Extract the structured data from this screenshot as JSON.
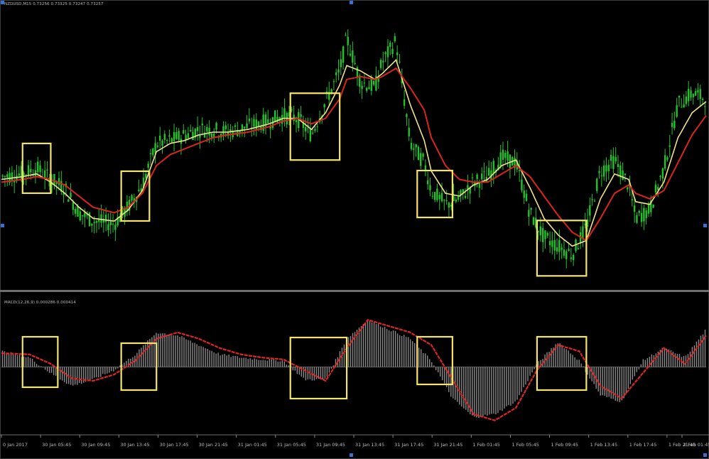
{
  "chart_data": [
    {
      "type": "line",
      "panel": "price",
      "title": "NZDUSD,M15 0.73256 0.73325 0.73247 0.73257",
      "x_ticks": [
        "0 Jan 2017",
        "30 Jan 05:45",
        "30 Jan 09:45",
        "30 Jan 13:45",
        "30 Jan 17:45",
        "30 Jan 21:45",
        "31 Jan 01:45",
        "31 Jan 05:45",
        "31 Jan 09:45",
        "31 Jan 13:45",
        "31 Jan 17:45",
        "31 Jan 21:45",
        "1 Feb 01:45",
        "1 Feb 05:45",
        "1 Feb 09:45",
        "1 Feb 13:45",
        "1 Feb 17:45",
        "1 Feb 21:45",
        "2 Feb 01:45"
      ],
      "x_range": [
        0,
        100
      ],
      "ylim": [
        0,
        100
      ],
      "series": [
        {
          "color": "#22c32a",
          "style": "candles",
          "x": [
            0,
            3,
            5,
            7,
            9,
            11,
            13,
            16,
            18,
            20,
            22,
            24,
            26,
            28,
            30,
            32,
            35,
            38,
            40,
            42,
            44,
            46,
            48,
            49,
            51,
            53,
            54,
            56,
            58,
            60,
            61,
            63,
            65,
            67,
            69,
            71,
            73,
            75,
            77,
            79,
            81,
            83,
            85,
            87,
            89,
            90,
            92,
            94,
            96,
            98,
            100
          ],
          "values": [
            40,
            41,
            43,
            39,
            36,
            27,
            24,
            23,
            29,
            37,
            52,
            53,
            55,
            57,
            57,
            56,
            58,
            60,
            62,
            61,
            55,
            67,
            78,
            90,
            74,
            72,
            81,
            89,
            52,
            45,
            35,
            30,
            32,
            38,
            40,
            47,
            45,
            27,
            18,
            15,
            12,
            22,
            42,
            46,
            37,
            25,
            28,
            43,
            66,
            70,
            68
          ]
        },
        {
          "color": "#f2e28c",
          "style": "line",
          "x": [
            0,
            3,
            5,
            7,
            9,
            11,
            13,
            16,
            18,
            20,
            22,
            24,
            26,
            28,
            30,
            32,
            35,
            38,
            40,
            42,
            44,
            46,
            48,
            49,
            51,
            53,
            54,
            56,
            58,
            60,
            61,
            63,
            65,
            67,
            69,
            71,
            73,
            75,
            77,
            79,
            81,
            83,
            85,
            87,
            89,
            90,
            92,
            94,
            96,
            98,
            100
          ],
          "values": [
            39,
            40,
            41,
            38,
            34,
            29,
            25,
            24,
            28,
            35,
            49,
            52,
            53,
            55,
            56,
            56,
            57,
            59,
            61,
            61,
            57,
            63,
            73,
            80,
            78,
            75,
            77,
            82,
            66,
            53,
            42,
            34,
            33,
            37,
            39,
            44,
            46,
            36,
            25,
            19,
            15,
            17,
            32,
            41,
            39,
            31,
            30,
            38,
            54,
            63,
            67
          ]
        },
        {
          "color": "#d9261c",
          "style": "line",
          "x": [
            0,
            3,
            5,
            7,
            9,
            11,
            13,
            16,
            18,
            20,
            22,
            24,
            26,
            28,
            30,
            32,
            35,
            38,
            40,
            42,
            44,
            46,
            48,
            49,
            51,
            53,
            54,
            56,
            58,
            60,
            61,
            63,
            65,
            67,
            69,
            71,
            73,
            75,
            77,
            79,
            81,
            83,
            85,
            87,
            89,
            90,
            92,
            94,
            96,
            98,
            100
          ],
          "values": [
            38,
            39,
            40,
            39,
            37,
            33,
            29,
            27,
            29,
            34,
            44,
            48,
            50,
            52,
            54,
            55,
            56,
            58,
            60,
            61,
            59,
            61,
            68,
            75,
            76,
            75,
            76,
            79,
            72,
            64,
            54,
            44,
            39,
            38,
            38,
            41,
            44,
            40,
            33,
            26,
            20,
            17,
            25,
            34,
            37,
            34,
            32,
            35,
            45,
            55,
            62
          ]
        }
      ],
      "annotations": {
        "type": "highlight-box",
        "color": "#f4e567",
        "x_ranges": [
          [
            3,
            7
          ],
          [
            17,
            21
          ],
          [
            41,
            48
          ],
          [
            59,
            64
          ],
          [
            76,
            83
          ]
        ]
      }
    },
    {
      "type": "bar",
      "panel": "macd",
      "title": "MACD(12,26,9) 0.000286 0.000414",
      "x_range": [
        0,
        100
      ],
      "ylim": [
        -100,
        100
      ],
      "histogram": {
        "color": "#8a8a8a",
        "x": [
          0,
          4,
          7,
          10,
          13,
          16,
          19,
          22,
          25,
          28,
          31,
          34,
          37,
          40,
          43,
          46,
          49,
          52,
          55,
          58,
          61,
          64,
          67,
          70,
          73,
          76,
          79,
          82,
          85,
          88,
          91,
          94,
          97,
          100
        ],
        "values": [
          25,
          15,
          -10,
          -30,
          -20,
          -5,
          20,
          55,
          50,
          35,
          20,
          15,
          12,
          10,
          -20,
          -20,
          45,
          75,
          60,
          45,
          10,
          -50,
          -80,
          -75,
          -55,
          5,
          40,
          10,
          -45,
          -55,
          10,
          30,
          15,
          60
        ]
      },
      "signal": {
        "color": "#e12424",
        "x": [
          0,
          4,
          7,
          10,
          13,
          16,
          19,
          22,
          25,
          28,
          31,
          34,
          37,
          40,
          43,
          46,
          49,
          52,
          55,
          58,
          61,
          64,
          67,
          70,
          73,
          76,
          79,
          82,
          85,
          88,
          91,
          94,
          97,
          100
        ],
        "values": [
          22,
          20,
          5,
          -18,
          -22,
          -12,
          10,
          45,
          55,
          45,
          30,
          20,
          15,
          12,
          -5,
          -22,
          30,
          75,
          65,
          55,
          35,
          -20,
          -75,
          -85,
          -65,
          -5,
          35,
          25,
          -30,
          -50,
          -10,
          30,
          5,
          50
        ]
      },
      "annotations": {
        "type": "highlight-box",
        "color": "#f4e567",
        "x_ranges": [
          [
            3,
            8
          ],
          [
            17,
            22
          ],
          [
            41,
            49
          ],
          [
            59,
            64
          ],
          [
            76,
            83
          ]
        ]
      }
    }
  ]
}
